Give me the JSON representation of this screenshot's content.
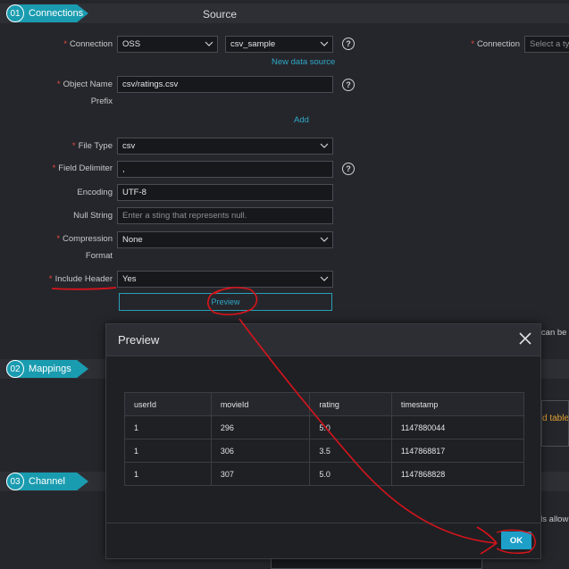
{
  "steps": [
    {
      "num": "01",
      "label": "Connections"
    },
    {
      "num": "02",
      "label": "Mappings"
    },
    {
      "num": "03",
      "label": "Channel"
    }
  ],
  "source": {
    "title": "Source",
    "connection_label": "Connection",
    "connection_type": "OSS",
    "connection_name": "csv_sample",
    "new_data_source": "New data source",
    "object_name_label": "Object Name",
    "object_name_value": "csv/ratings.csv",
    "prefix_label": "Prefix",
    "add_link": "Add",
    "file_type_label": "File Type",
    "file_type_value": "csv",
    "field_delimiter_label": "Field Delimiter",
    "field_delimiter_value": ",",
    "encoding_label": "Encoding",
    "encoding_value": "UTF-8",
    "null_string_label": "Null String",
    "null_string_placeholder": "Enter a sting that represents null.",
    "compression_label": "Compression",
    "compression_label2": "Format",
    "compression_value": "None",
    "include_header_label": "Include Header",
    "include_header_value": "Yes",
    "preview_button": "Preview"
  },
  "target": {
    "connection_label": "Connection",
    "connection_placeholder": "Select a ty"
  },
  "clipped": {
    "can_be": "n can be",
    "d_table": "d table",
    "ds_allow": "ds allow"
  },
  "modal": {
    "title": "Preview",
    "columns": [
      "userId",
      "movieId",
      "rating",
      "timestamp"
    ],
    "rows": [
      [
        "1",
        "296",
        "5.0",
        "1147880044"
      ],
      [
        "1",
        "306",
        "3.5",
        "1147868817"
      ],
      [
        "1",
        "307",
        "5.0",
        "1147868828"
      ]
    ],
    "ok_button": "OK"
  },
  "colors": {
    "accent": "#1a9cb0",
    "required": "#e84a3c",
    "link": "#2fa8c8",
    "annotation": "#d8141c"
  }
}
